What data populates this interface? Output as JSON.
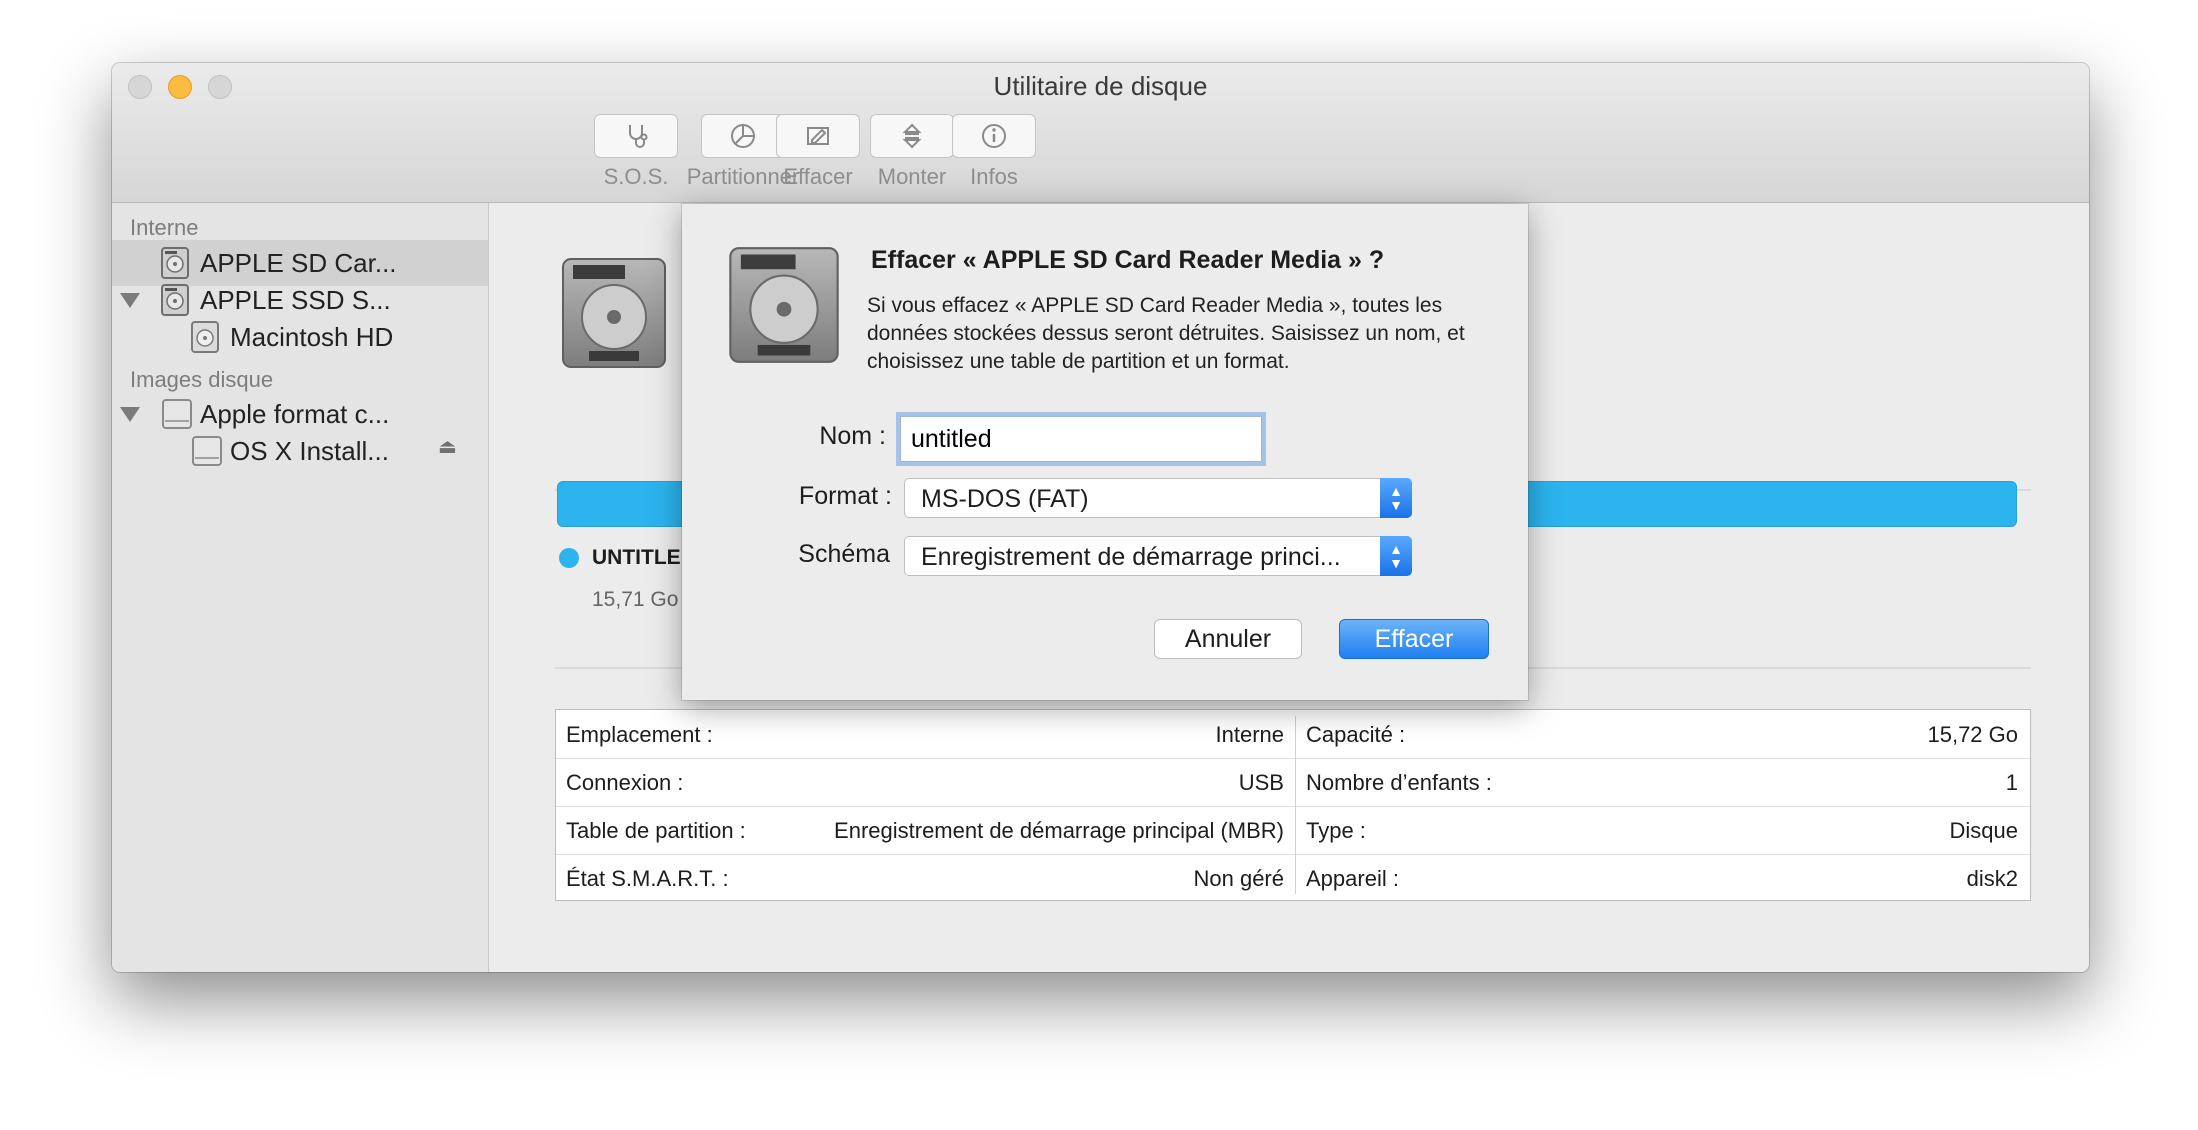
{
  "window": {
    "title": "Utilitaire de disque"
  },
  "toolbar": [
    {
      "label": "S.O.S.",
      "icon": "stethoscope-icon"
    },
    {
      "label": "Partitionner",
      "icon": "pie-chart-icon"
    },
    {
      "label": "Effacer",
      "icon": "eraser-icon"
    },
    {
      "label": "Monter",
      "icon": "mount-icon"
    },
    {
      "label": "Infos",
      "icon": "info-icon"
    }
  ],
  "sidebar": {
    "section_internal": "Interne",
    "section_images": "Images disque",
    "items": [
      {
        "label": "APPLE SD Car...",
        "icon": "hard-disk-icon",
        "selected": true
      },
      {
        "label": "APPLE SSD S...",
        "icon": "hard-disk-icon"
      },
      {
        "label": "Macintosh HD",
        "icon": "volume-icon"
      },
      {
        "label": "Apple format c...",
        "icon": "disk-image-icon"
      },
      {
        "label": "OS X Install...",
        "icon": "disk-image-icon"
      }
    ],
    "eject_glyph": "⏏"
  },
  "main": {
    "partition_name": "UNTITLE",
    "partition_size": "15,71 Go",
    "bar_color": "#2cb4ef",
    "info_left": [
      {
        "k": "Emplacement :",
        "v": "Interne"
      },
      {
        "k": "Connexion :",
        "v": "USB"
      },
      {
        "k": "Table de partition :",
        "v": "Enregistrement de démarrage principal (MBR)"
      },
      {
        "k": "État S.M.A.R.T. :",
        "v": "Non géré"
      }
    ],
    "info_right": [
      {
        "k": "Capacité :",
        "v": "15,72 Go"
      },
      {
        "k": "Nombre d’enfants :",
        "v": "1"
      },
      {
        "k": "Type :",
        "v": "Disque"
      },
      {
        "k": "Appareil :",
        "v": "disk2"
      }
    ]
  },
  "dialog": {
    "title": "Effacer « APPLE SD Card Reader Media » ?",
    "message": "Si vous effacez « APPLE SD Card Reader Media », toutes les données stockées dessus seront détruites. Saisissez un nom, et choisissez une table de partition et un format.",
    "name_label": "Nom :",
    "name_value": "untitled",
    "format_label": "Format :",
    "format_value": "MS-DOS (FAT)",
    "scheme_label": "Schéma",
    "scheme_value": "Enregistrement de démarrage princi...",
    "cancel_label": "Annuler",
    "confirm_label": "Effacer",
    "accent": "#1f80f0"
  }
}
